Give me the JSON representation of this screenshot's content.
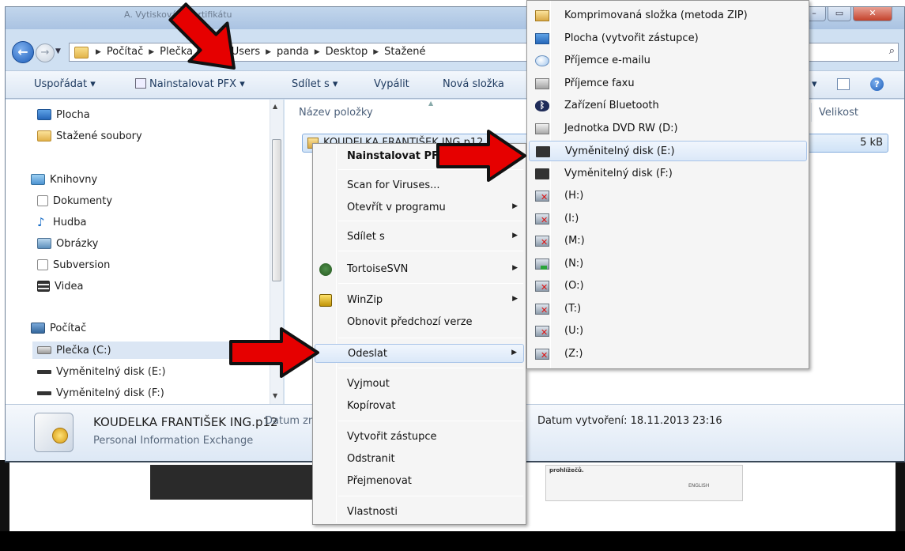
{
  "window": {
    "title": "A. Vytiskování certifikátu"
  },
  "address": {
    "crumbs": [
      "Počítač",
      "Plečka (C:)",
      "Users",
      "panda",
      "Desktop",
      "Stažené"
    ]
  },
  "toolbar": {
    "organize": "Uspořádat",
    "install": "Nainstalovat PFX",
    "share": "Sdílet s",
    "burn": "Vypálit",
    "new_folder": "Nová složka"
  },
  "nav": {
    "favorites": [
      {
        "label": "Plocha",
        "icon": "desktop-icon"
      },
      {
        "label": "Stažené soubory",
        "icon": "downloads-folder-icon"
      }
    ],
    "libraries_label": "Knihovny",
    "libraries": [
      {
        "label": "Dokumenty",
        "icon": "documents-icon"
      },
      {
        "label": "Hudba",
        "icon": "music-icon"
      },
      {
        "label": "Obrázky",
        "icon": "pictures-icon"
      },
      {
        "label": "Subversion",
        "icon": "subversion-icon"
      },
      {
        "label": "Videa",
        "icon": "videos-icon"
      }
    ],
    "computer_label": "Počítač",
    "drives": [
      {
        "label": "Plečka (C:)",
        "icon": "hard-drive-icon"
      },
      {
        "label": "Vyměnitelný disk (E:)",
        "icon": "removable-disk-icon"
      },
      {
        "label": "Vyměnitelný disk (F:)",
        "icon": "removable-disk-icon"
      }
    ]
  },
  "content": {
    "col_name": "Název položky",
    "col_size": "Velikost",
    "file_name": "KOUDELKA FRANTIŠEK ING.p12",
    "file_size": "5 kB"
  },
  "details": {
    "file_name": "KOUDELKA FRANTIŠEK ING.p12",
    "file_type": "Personal Information Exchange",
    "modified_label": "Datum změny: 18.11.2013 23:16",
    "created": "Datum vytvoření: 18.11.2013 23:16"
  },
  "context_menu": {
    "install": "Nainstalovat PFX",
    "scan": "Scan for Viruses...",
    "open_with": "Otevřít v programu",
    "share_with": "Sdílet s",
    "tortoise": "TortoiseSVN",
    "winzip": "WinZip",
    "restore": "Obnovit předchozí verze",
    "send_to": "Odeslat",
    "cut": "Vyjmout",
    "copy": "Kopírovat",
    "create_shortcut": "Vytvořit zástupce",
    "delete": "Odstranit",
    "rename": "Přejmenovat",
    "properties": "Vlastnosti"
  },
  "send_to": {
    "items": [
      "Komprimovaná složka (metoda ZIP)",
      "Plocha (vytvořit zástupce)",
      "Příjemce e-mailu",
      "Příjemce faxu",
      "Zařízení Bluetooth",
      "Jednotka DVD RW (D:)",
      "Vyměnitelný disk (E:)",
      "Vyměnitelný disk (F:)",
      "(H:)",
      "(I:)",
      "(M:)",
      "(N:)",
      "(O:)",
      "(T:)",
      "(U:)",
      "(Z:)"
    ]
  },
  "background_doc": {
    "snippet": "prohlížečů.",
    "lang": "ENGLISH"
  },
  "colors": {
    "arrow": "#e60000",
    "highlight": "#dbe8f8",
    "window_frame": "#cfe0f2"
  }
}
